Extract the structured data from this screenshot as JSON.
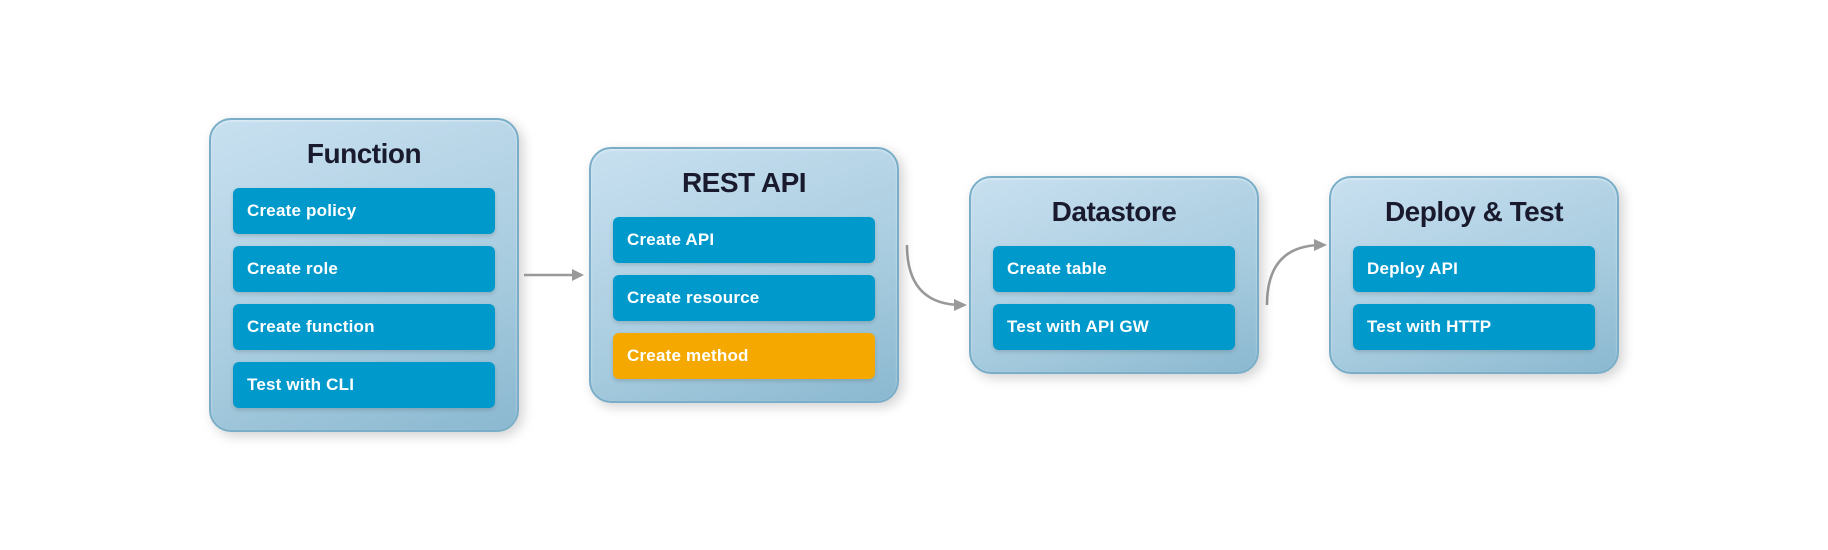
{
  "panels": [
    {
      "id": "function",
      "title": "Function",
      "items": [
        {
          "label": "Create policy",
          "style": "teal"
        },
        {
          "label": "Create role",
          "style": "teal"
        },
        {
          "label": "Create function",
          "style": "teal"
        },
        {
          "label": "Test with CLI",
          "style": "teal"
        }
      ]
    },
    {
      "id": "rest-api",
      "title": "REST API",
      "items": [
        {
          "label": "Create API",
          "style": "teal"
        },
        {
          "label": "Create resource",
          "style": "teal"
        },
        {
          "label": "Create method",
          "style": "orange"
        }
      ]
    },
    {
      "id": "datastore",
      "title": "Datastore",
      "items": [
        {
          "label": "Create table",
          "style": "teal"
        },
        {
          "label": "Test with API GW",
          "style": "teal"
        }
      ]
    },
    {
      "id": "deploy-test",
      "title": "Deploy & Test",
      "items": [
        {
          "label": "Deploy API",
          "style": "teal"
        },
        {
          "label": "Test with HTTP",
          "style": "teal"
        }
      ]
    }
  ],
  "arrows": [
    {
      "id": "arrow-1",
      "type": "straight"
    },
    {
      "id": "arrow-2",
      "type": "curved-down"
    },
    {
      "id": "arrow-3",
      "type": "curved-up"
    }
  ]
}
